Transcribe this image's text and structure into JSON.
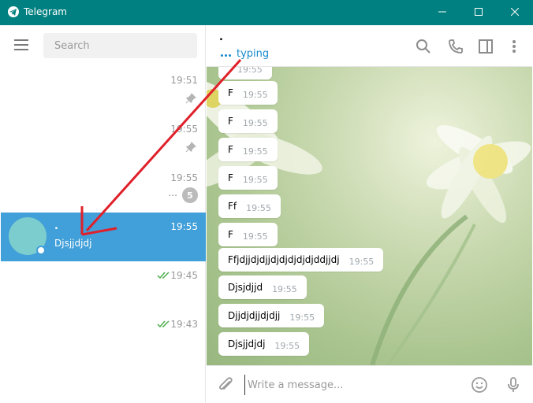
{
  "window": {
    "title": "Telegram",
    "icons": [
      "telegram-logo-icon",
      "minimize-icon",
      "maximize-icon",
      "close-icon"
    ]
  },
  "sidebar": {
    "search_placeholder": "Search",
    "chats": [
      {
        "name": "",
        "preview": "",
        "time": "19:51",
        "pinned": true
      },
      {
        "name": "",
        "preview": "",
        "time": "19:55",
        "pinned": true
      },
      {
        "name": "",
        "preview": "...",
        "time": "19:55",
        "unread": "5"
      },
      {
        "name": ".",
        "preview": "Djsjjdjdj",
        "time": "19:55",
        "active": true,
        "online": true
      },
      {
        "name": "",
        "preview": "",
        "time": "19:45",
        "read": true
      },
      {
        "name": "",
        "preview": "",
        "time": "19:43",
        "read": true
      }
    ]
  },
  "header": {
    "peer_name": ".",
    "status": "typing",
    "icons": [
      "search-icon",
      "phone-icon",
      "sidebar-toggle-icon",
      "more-icon"
    ]
  },
  "messages": [
    {
      "text": "F",
      "time": "19:55"
    },
    {
      "text": "F",
      "time": "19:55"
    },
    {
      "text": "F",
      "time": "19:55"
    },
    {
      "text": "F",
      "time": "19:55"
    },
    {
      "text": "Ff",
      "time": "19:55"
    },
    {
      "text": "F",
      "time": "19:55"
    },
    {
      "text": "Ffjdjjdjdjjdjdjdjdjdjddjjdj",
      "time": "19:55"
    },
    {
      "text": "Djsjdjjd",
      "time": "19:55"
    },
    {
      "text": "Djjdjdjjdjdjj",
      "time": "19:55"
    },
    {
      "text": "Djsjjdjdj",
      "time": "19:55"
    }
  ],
  "top_partial_time": "19:55",
  "composer": {
    "placeholder": "Write a message...",
    "icons": [
      "attach-icon",
      "emoji-icon",
      "microphone-icon"
    ]
  },
  "colors": {
    "titlebar": "#008080",
    "active_chat": "#419fd9",
    "accent": "#168acd",
    "read_checks": "#4fae4e",
    "annotation_arrow": "#e0202a"
  }
}
